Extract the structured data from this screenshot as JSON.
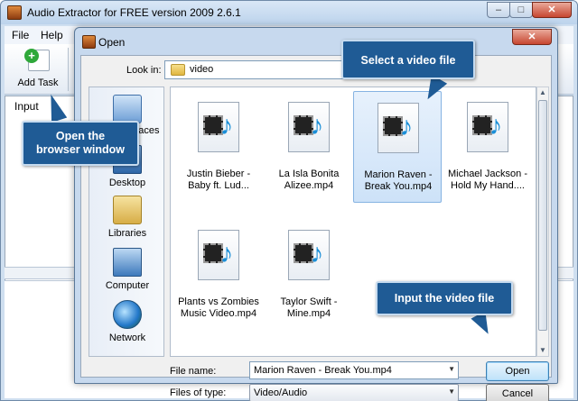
{
  "app": {
    "title": "Audio Extractor for FREE version 2009  2.6.1",
    "menu": [
      "File",
      "Help"
    ],
    "toolbar": {
      "add_task_label": "Add Task"
    },
    "input_label": "Input"
  },
  "dialog": {
    "title": "Open",
    "look_in_label": "Look in:",
    "look_in_value": "video",
    "places": [
      {
        "label": "Recent Places",
        "icon": "recent-places-icon"
      },
      {
        "label": "Desktop",
        "icon": "desktop-icon"
      },
      {
        "label": "Libraries",
        "icon": "libraries-icon"
      },
      {
        "label": "Computer",
        "icon": "computer-icon"
      },
      {
        "label": "Network",
        "icon": "network-icon"
      }
    ],
    "files": [
      {
        "line1": "Justin Bieber -",
        "line2": "Baby ft. Lud...",
        "selected": false
      },
      {
        "line1": "La Isla Bonita",
        "line2": "Alizee.mp4",
        "selected": false
      },
      {
        "line1": "Marion Raven -",
        "line2": "Break You.mp4",
        "selected": true
      },
      {
        "line1": "Michael Jackson -",
        "line2": "Hold My Hand....",
        "selected": false
      },
      {
        "line1": "Plants vs Zombies",
        "line2": "Music Video.mp4",
        "selected": false
      },
      {
        "line1": "Taylor Swift -",
        "line2": "Mine.mp4",
        "selected": false
      }
    ],
    "file_name_label": "File name:",
    "file_name_value": "Marion Raven - Break You.mp4",
    "file_type_label": "Files of type:",
    "file_type_value": "Video/Audio",
    "open_button": "Open",
    "cancel_button": "Cancel"
  },
  "callouts": {
    "browser": "Open the browser window",
    "select": "Select a video file",
    "input": "Input the video file"
  },
  "colors": {
    "callout": "#1f5b95",
    "selection": "#cde2f8"
  }
}
